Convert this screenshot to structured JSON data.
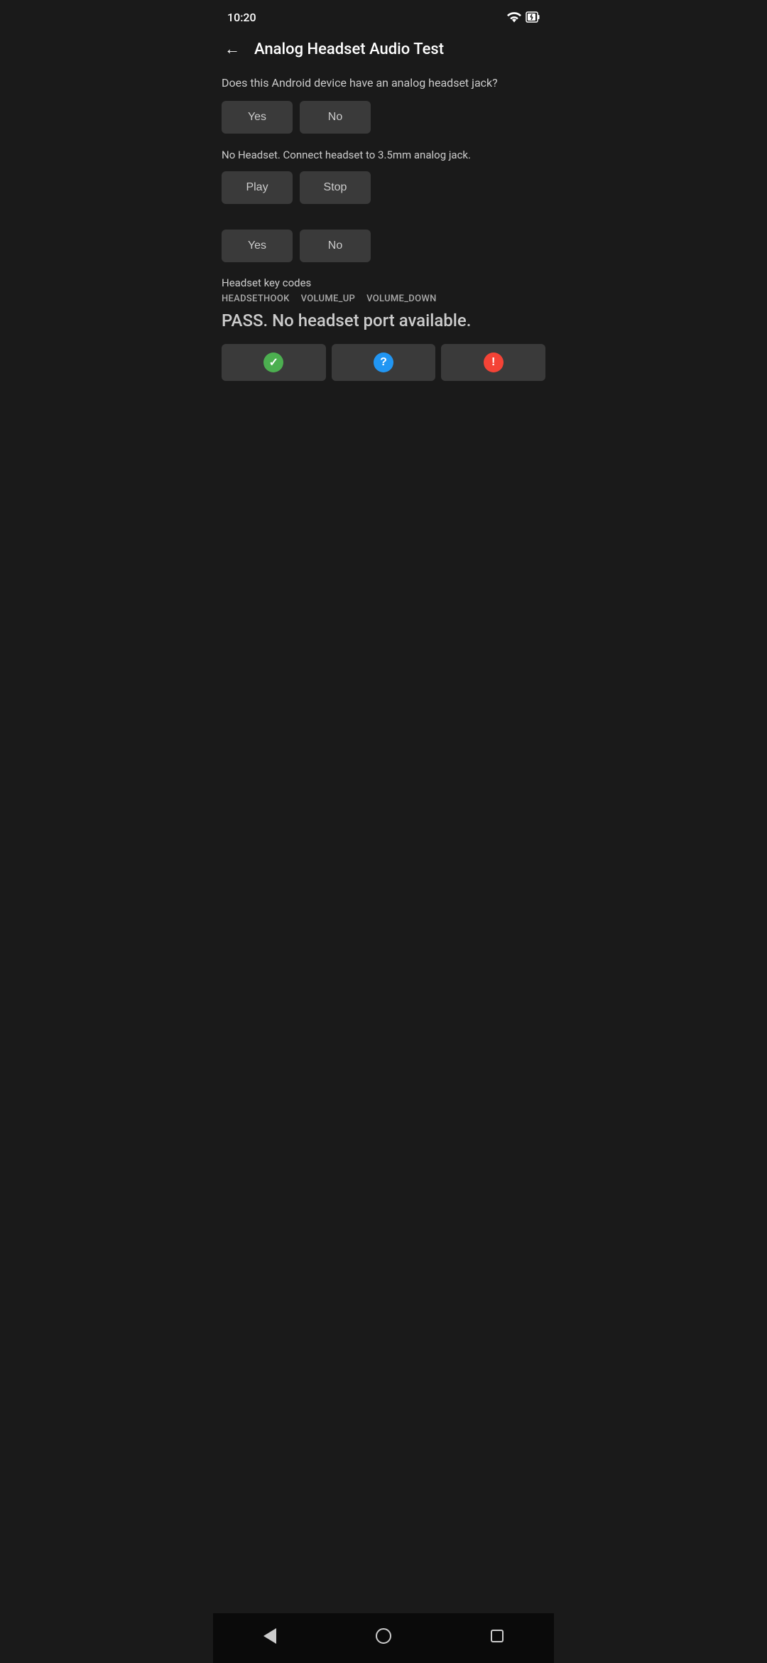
{
  "status_bar": {
    "time": "10:20"
  },
  "header": {
    "title": "Analog Headset Audio Test",
    "back_label": "←"
  },
  "question_section": {
    "question_text": "Does this Android device have an analog headset jack?",
    "yes_label": "Yes",
    "no_label": "No"
  },
  "playback_section": {
    "info_text": "No Headset. Connect headset to 3.5mm analog jack.",
    "play_label": "Play",
    "stop_label": "Stop"
  },
  "response_section": {
    "yes_label": "Yes",
    "no_label": "No"
  },
  "key_codes_section": {
    "title": "Headset key codes",
    "codes": [
      "HEADSETHOOK",
      "VOLUME_UP",
      "VOLUME_DOWN"
    ]
  },
  "pass_section": {
    "pass_text": "PASS. No headset port available."
  },
  "result_buttons": {
    "pass_icon": "✓",
    "question_icon": "?",
    "fail_icon": "!"
  },
  "nav_bar": {
    "back_title": "back",
    "home_title": "home",
    "recents_title": "recents"
  }
}
